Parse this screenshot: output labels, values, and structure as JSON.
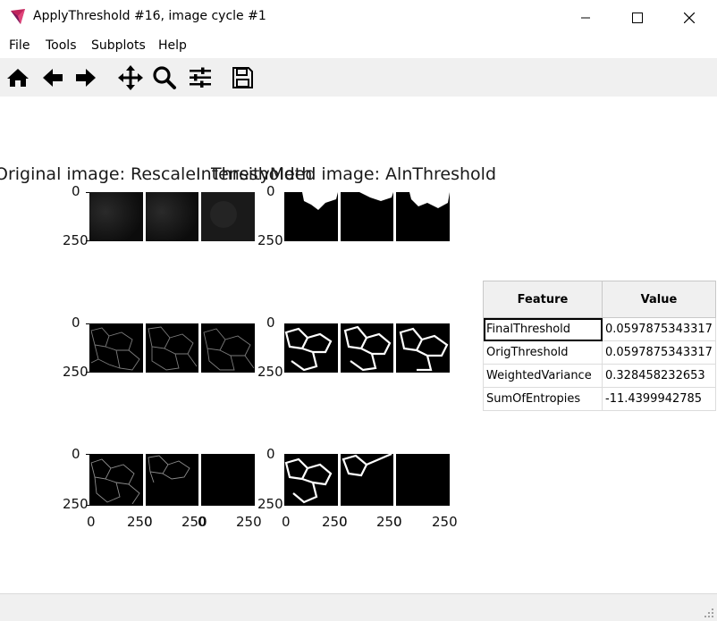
{
  "window": {
    "title": "ApplyThreshold #16, image cycle #1",
    "buttons": [
      "minimize",
      "maximize",
      "close"
    ]
  },
  "menu": {
    "items": [
      "File",
      "Tools",
      "Subplots",
      "Help"
    ]
  },
  "toolbar": {
    "icons": [
      "home-icon",
      "back-arrow-icon",
      "forward-arrow-icon",
      "pan-icon",
      "zoom-icon",
      "configure-subplots-icon",
      "save-icon"
    ]
  },
  "figure": {
    "left_title": "Original image: RescaleIntensityMeth",
    "right_title": "Thresholded image: AlnThreshold",
    "y_ticks": [
      "0",
      "250"
    ],
    "x_ticks": [
      "0",
      "250",
      "0",
      "250",
      "0",
      "250"
    ]
  },
  "table": {
    "headers": [
      "Feature",
      "Value"
    ],
    "rows": [
      {
        "feature": "FinalThreshold",
        "value": "0.0597875343317"
      },
      {
        "feature": "OrigThreshold",
        "value": "0.0597875343317"
      },
      {
        "feature": "WeightedVariance",
        "value": "0.328458232653"
      },
      {
        "feature": "SumOfEntropies",
        "value": "-11.4399942785"
      }
    ]
  },
  "colors": {
    "toolbar_bg": "#f0f0f0",
    "image_bg": "#000000",
    "table_header_bg": "#f0f0f0"
  }
}
